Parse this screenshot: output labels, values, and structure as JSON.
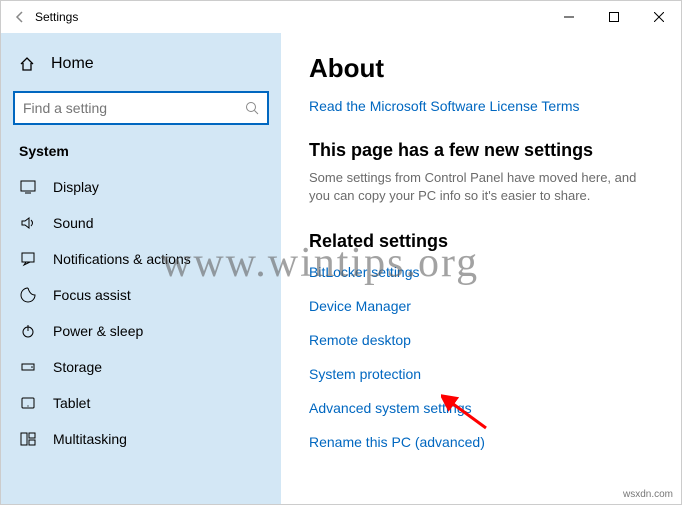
{
  "window": {
    "title": "Settings"
  },
  "sidebar": {
    "home_label": "Home",
    "search_placeholder": "Find a setting",
    "group_label": "System",
    "items": [
      {
        "label": "Display",
        "icon": "display-icon"
      },
      {
        "label": "Sound",
        "icon": "sound-icon"
      },
      {
        "label": "Notifications & actions",
        "icon": "notifications-icon"
      },
      {
        "label": "Focus assist",
        "icon": "focus-assist-icon"
      },
      {
        "label": "Power & sleep",
        "icon": "power-icon"
      },
      {
        "label": "Storage",
        "icon": "storage-icon"
      },
      {
        "label": "Tablet",
        "icon": "tablet-icon"
      },
      {
        "label": "Multitasking",
        "icon": "multitasking-icon"
      }
    ]
  },
  "main": {
    "title": "About",
    "license_link": "Read the Microsoft Software License Terms",
    "new_heading": "This page has a few new settings",
    "new_desc": "Some settings from Control Panel have moved here, and you can copy your PC info so it's easier to share.",
    "related_heading": "Related settings",
    "related_links": [
      "BitLocker settings",
      "Device Manager",
      "Remote desktop",
      "System protection",
      "Advanced system settings",
      "Rename this PC (advanced)"
    ]
  },
  "watermark": {
    "site": "www.wintips.org",
    "corner": "wsxdn.com"
  }
}
